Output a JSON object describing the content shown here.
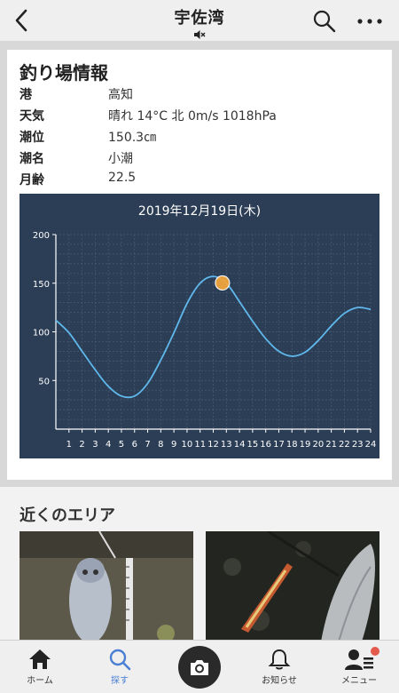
{
  "header": {
    "title": "宇佐湾",
    "back_icon": "chevron-left-icon",
    "mute_icon": "speaker-mute-icon",
    "search_icon": "search-icon",
    "more_icon": "more-dots-icon"
  },
  "info": {
    "title": "釣り場情報",
    "rows": [
      {
        "label": "港",
        "value": "高知"
      },
      {
        "label": "天気",
        "value": "晴れ 14°C 北 0m/s 1018hPa"
      },
      {
        "label": "潮位",
        "value": "150.3㎝"
      },
      {
        "label": "潮名",
        "value": "小潮"
      },
      {
        "label": "月齢",
        "value": "22.5"
      }
    ]
  },
  "chart_data": {
    "type": "line",
    "title": "2019年12月19日(木)",
    "x": [
      0,
      1,
      2,
      3,
      4,
      5,
      6,
      7,
      8,
      9,
      10,
      11,
      12,
      13,
      14,
      15,
      16,
      17,
      18,
      19,
      20,
      21,
      22,
      23,
      24
    ],
    "y": [
      112,
      99,
      80,
      61,
      44,
      34,
      34,
      47,
      71,
      99,
      129,
      150,
      157,
      150,
      131,
      111,
      93,
      80,
      75,
      79,
      91,
      106,
      119,
      125,
      123
    ],
    "xticks": [
      "1",
      "2",
      "3",
      "4",
      "5",
      "6",
      "7",
      "8",
      "9",
      "10",
      "11",
      "12",
      "13",
      "14",
      "15",
      "16",
      "17",
      "18",
      "19",
      "20",
      "21",
      "22",
      "23",
      "24"
    ],
    "yticks": [
      "50",
      "100",
      "150",
      "200"
    ],
    "ylim": [
      0,
      200
    ],
    "xlim": [
      0,
      24
    ],
    "marker": {
      "x": 12.7,
      "y": 150.3
    },
    "colors": {
      "background": "#2c3e56",
      "line": "#5fb8ec",
      "marker": "#f0a53d",
      "grid": "#4a5c74",
      "text": "#ffffff"
    },
    "grid": true
  },
  "nearby": {
    "title": "近くのエリア"
  },
  "tabs": [
    {
      "label": "ホーム",
      "icon": "home-icon"
    },
    {
      "label": "探す",
      "icon": "search-icon"
    },
    {
      "label": "",
      "icon": "camera-icon"
    },
    {
      "label": "お知らせ",
      "icon": "bell-icon"
    },
    {
      "label": "メニュー",
      "icon": "user-menu-icon"
    }
  ]
}
